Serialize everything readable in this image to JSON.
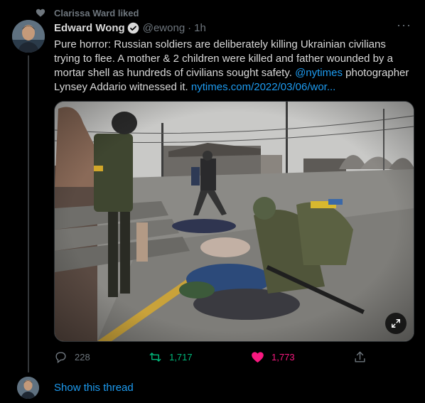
{
  "social_context": {
    "text": "Clarissa Ward liked",
    "icon": "heart-icon"
  },
  "tweet": {
    "author": {
      "display_name": "Edward Wong",
      "handle": "@ewong",
      "verified": true
    },
    "separator": "·",
    "time": "1h",
    "more_icon": "more-icon",
    "text": {
      "part1": "Pure horror: Russian soldiers are deliberately killing Ukrainian civilians trying to flee. A mother & 2 children were killed and father wounded by a mortar shell as hundreds of civilians sought safety. ",
      "mention": "@nytimes",
      "part2": " photographer Lynsey Addario witnessed it. ",
      "url": "nytimes.com/2022/03/06/wor..."
    },
    "media": {
      "expand_icon": "expand-icon"
    },
    "actions": {
      "reply": {
        "icon": "reply-icon",
        "count": "228"
      },
      "retweet": {
        "icon": "retweet-icon",
        "count": "1,717",
        "color": "#00ba7c"
      },
      "like": {
        "icon": "heart-filled-icon",
        "count": "1,773",
        "color": "#f91880"
      },
      "share": {
        "icon": "share-icon"
      }
    }
  },
  "thread": {
    "show_label": "Show this thread"
  },
  "colors": {
    "background": "#000000",
    "text": "#d9d9d9",
    "muted": "#6e767d",
    "link": "#1d9bf0"
  }
}
